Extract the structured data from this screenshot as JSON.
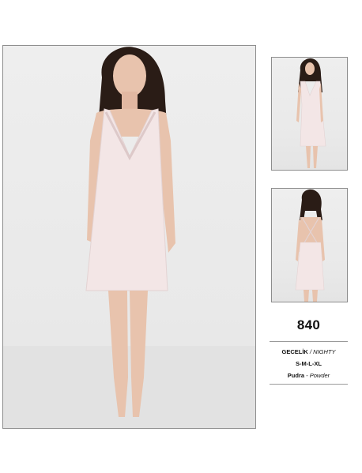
{
  "product": {
    "model_number": "840",
    "category_tr": "GECELİK",
    "separator": "/",
    "category_en": "NIGHTY",
    "sizes": "S-M-L-XL",
    "color_tr": "Pudra",
    "color_separator": "-",
    "color_en": "Powder"
  },
  "colors": {
    "background": "#ffffff",
    "photo_backdrop": "#eeeeee",
    "garment": "#f3e6e6",
    "hair": "#2a1c16",
    "skin": "#e8c3ad",
    "frame_border": "#8d8d8d",
    "rule": "#9a9a9a"
  },
  "images": [
    {
      "id": "main-photo",
      "subject": "model wearing powder nightdress, front view"
    },
    {
      "id": "front-photo",
      "subject": "front view thumbnail"
    },
    {
      "id": "back-photo",
      "subject": "back view thumbnail with cross straps"
    }
  ]
}
